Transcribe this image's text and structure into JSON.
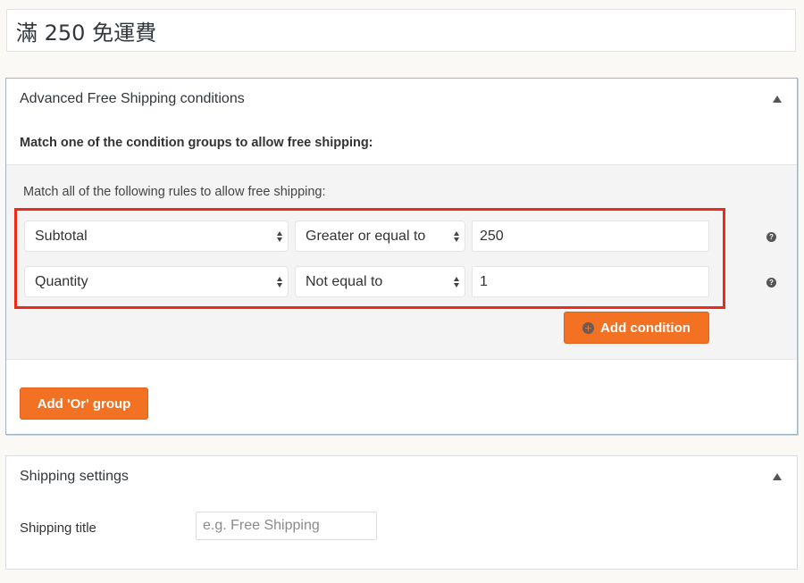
{
  "post_title": "滿 250 免運費",
  "conditions_box": {
    "title": "Advanced Free Shipping conditions",
    "intro": "Match one of the condition groups to allow free shipping:",
    "group": {
      "label": "Match all of the following rules to allow free shipping:",
      "rules": [
        {
          "condition": "Subtotal",
          "operator": "Greater or equal to",
          "value": "250",
          "help": "?"
        },
        {
          "condition": "Quantity",
          "operator": "Not equal to",
          "value": "1",
          "help": "?"
        }
      ],
      "add_condition_label": "Add condition"
    },
    "add_or_group_label": "Add 'Or' group"
  },
  "shipping_settings": {
    "title": "Shipping settings",
    "shipping_title_label": "Shipping title",
    "shipping_title_value": "",
    "shipping_title_placeholder": "e.g. Free Shipping"
  },
  "colors": {
    "accent": "#f27123",
    "highlight": "#ee2b1a"
  }
}
